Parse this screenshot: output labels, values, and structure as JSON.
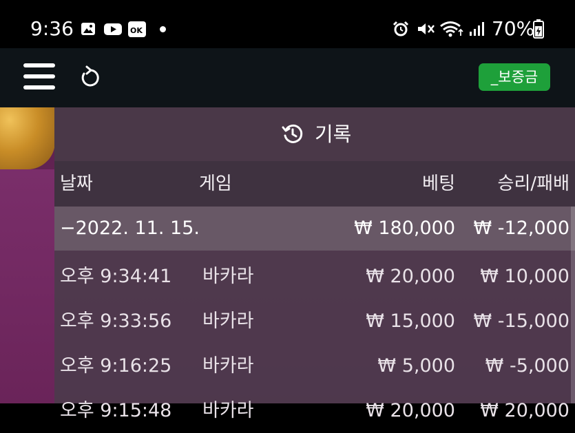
{
  "status_bar": {
    "time": "9:36",
    "battery": "70%",
    "icons": [
      "gallery-icon",
      "youtube-icon",
      "ok-icon",
      "dot",
      "alarm-icon",
      "mute-icon",
      "wifi-icon",
      "signal-icon",
      "battery-icon"
    ]
  },
  "app_bar": {
    "menu_icon": "hamburger-menu-icon",
    "refresh_icon": "refresh-icon",
    "deposit_label": "_보증금",
    "deposit_color": "#1ea03a"
  },
  "history": {
    "title": "기록",
    "icon": "history-icon",
    "columns": {
      "date": "날짜",
      "game": "게임",
      "bet": "베팅",
      "result": "승리/패배"
    },
    "date_group": {
      "date": "−2022. 11. 15.",
      "bet": "₩ 180,000",
      "result": "₩ -12,000"
    },
    "rows": [
      {
        "time": "오후 9:34:41",
        "game": "바카라",
        "bet": "₩ 20,000",
        "result": "₩ 10,000"
      },
      {
        "time": "오후 9:33:56",
        "game": "바카라",
        "bet": "₩ 15,000",
        "result": "₩ -15,000"
      },
      {
        "time": "오후 9:16:25",
        "game": "바카라",
        "bet": "₩ 5,000",
        "result": "₩ -5,000"
      },
      {
        "time": "오후 9:15:48",
        "game": "바카라",
        "bet": "₩ 20,000",
        "result": "₩ 20,000"
      }
    ]
  }
}
